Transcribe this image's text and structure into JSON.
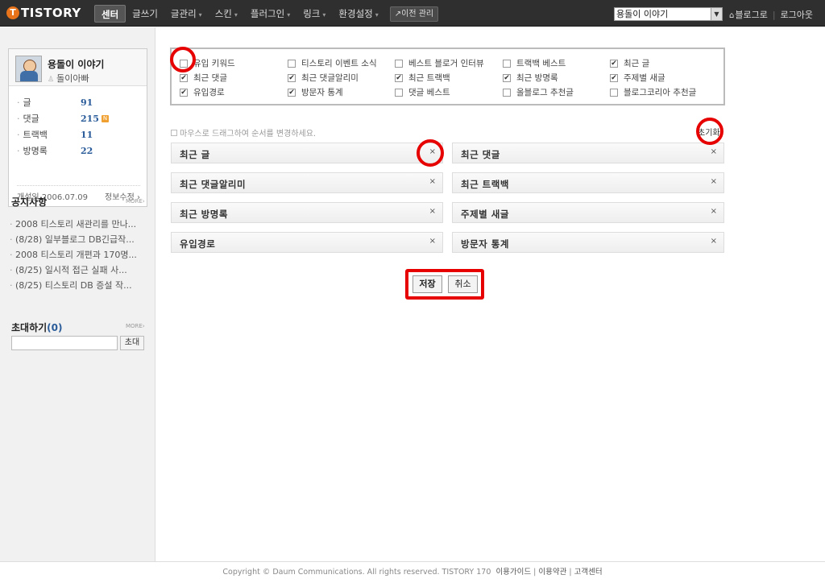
{
  "header": {
    "logo_letter": "T",
    "logo_text": "TISTORY",
    "nav": [
      {
        "label": "센터",
        "active": true
      },
      {
        "label": "글쓰기",
        "active": false
      },
      {
        "label": "글관리",
        "active": false,
        "dropdown": true
      },
      {
        "label": "스킨",
        "active": false,
        "dropdown": true
      },
      {
        "label": "플러그인",
        "active": false,
        "dropdown": true
      },
      {
        "label": "링크",
        "active": false,
        "dropdown": true
      },
      {
        "label": "환경설정",
        "active": false,
        "dropdown": true
      }
    ],
    "prev_admin": "↗이전 관리",
    "blog_select": "용돌이 이야기",
    "blog_link": "블로그로",
    "logout": "로그아웃"
  },
  "sidebar": {
    "profile": {
      "blog_name": "용돌이 이야기",
      "user": "돌이아빠",
      "stats": [
        {
          "label": "글",
          "value": "91"
        },
        {
          "label": "댓글",
          "value": "215",
          "new": "N"
        },
        {
          "label": "트랙백",
          "value": "11"
        },
        {
          "label": "방명록",
          "value": "22"
        }
      ],
      "open_date": "개설일 2006.07.09",
      "edit_info": "정보수정 ›"
    },
    "notice": {
      "title": "공지사항",
      "more": "MORE›",
      "items": [
        "2008 티스토리 새관리를 만나...",
        "(8/28) 일부블로그 DB긴급작...",
        "2008 티스토리 개편과 170명...",
        "(8/25) 일시적 접근 실패 사...",
        "(8/25) 티스토리 DB 증설 작..."
      ]
    },
    "invite": {
      "title": "초대하기",
      "count": "(0)",
      "more": "MORE›",
      "input_value": "",
      "button": "초대"
    }
  },
  "main": {
    "widgets": [
      {
        "label": "유입 키워드",
        "checked": false
      },
      {
        "label": "티스토리 이벤트 소식",
        "checked": false
      },
      {
        "label": "베스트 블로거 인터뷰",
        "checked": false
      },
      {
        "label": "트랙백 베스트",
        "checked": false
      },
      {
        "label": "최근 글",
        "checked": true
      },
      {
        "label": "최근 댓글",
        "checked": true
      },
      {
        "label": "최근 댓글알리미",
        "checked": true
      },
      {
        "label": "최근 트랙백",
        "checked": true
      },
      {
        "label": "최근 방명록",
        "checked": true
      },
      {
        "label": "주제별 새글",
        "checked": true
      },
      {
        "label": "유입경로",
        "checked": true
      },
      {
        "label": "방문자 통계",
        "checked": true
      },
      {
        "label": "댓글 베스트",
        "checked": false
      },
      {
        "label": "올블로그 추천글",
        "checked": false
      },
      {
        "label": "블로그코리아 추천글",
        "checked": false
      }
    ],
    "drag_hint": "마우스로 드래그하여 순서를 변경하세요.",
    "reset": "초기화",
    "slots": [
      {
        "label": "최근 글"
      },
      {
        "label": "최근 댓글"
      },
      {
        "label": "최근 댓글알리미"
      },
      {
        "label": "최근 트랙백"
      },
      {
        "label": "최근 방명록"
      },
      {
        "label": "주제별 새글"
      },
      {
        "label": "유입경로"
      },
      {
        "label": "방문자 통계"
      }
    ],
    "close_glyph": "×",
    "save": "저장",
    "cancel": "취소"
  },
  "footer": {
    "copyright": "Copyright © Daum Communications. All rights reserved. TISTORY 170",
    "links": [
      "이용가이드",
      "이용약관",
      "고객센터"
    ]
  }
}
